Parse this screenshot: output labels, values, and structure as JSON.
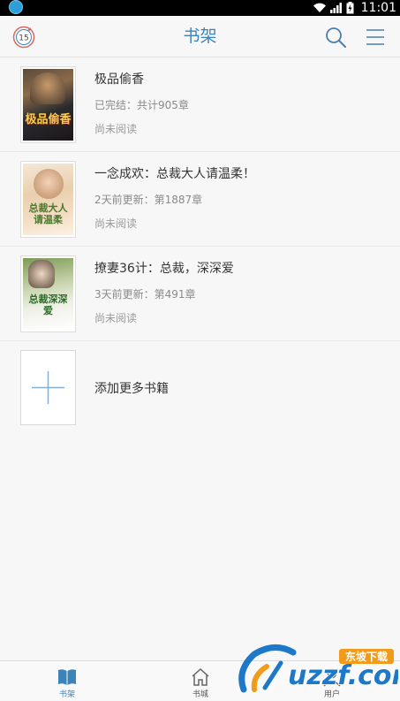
{
  "status_bar": {
    "time": "11:01",
    "battery_level": "charging"
  },
  "app_bar": {
    "title": "书架",
    "logo_text": "15"
  },
  "books": [
    {
      "title": "极品偷香",
      "status": "已完结：共计905章",
      "progress": "尚未阅读",
      "cover_text": "极品偷香"
    },
    {
      "title": "一念成欢：总裁大人请温柔！",
      "status": "2天前更新：第1887章",
      "progress": "尚未阅读",
      "cover_text": "总裁大人请温柔"
    },
    {
      "title": "撩妻36计：总裁，深深爱",
      "status": "3天前更新：第491章",
      "progress": "尚未阅读",
      "cover_text": "总裁深深爱"
    }
  ],
  "add_more": {
    "label": "添加更多书籍"
  },
  "bottom_nav": [
    {
      "label": "书架",
      "icon": "book-open-icon",
      "active": true
    },
    {
      "label": "书城",
      "icon": "home-icon",
      "active": false
    },
    {
      "label": "用户",
      "icon": "user-icon",
      "active": false
    }
  ],
  "watermark": {
    "brand": "uzzf.com",
    "cn": "东坡下载"
  },
  "colors": {
    "accent": "#3d83b8",
    "background": "#f7f7f7"
  }
}
